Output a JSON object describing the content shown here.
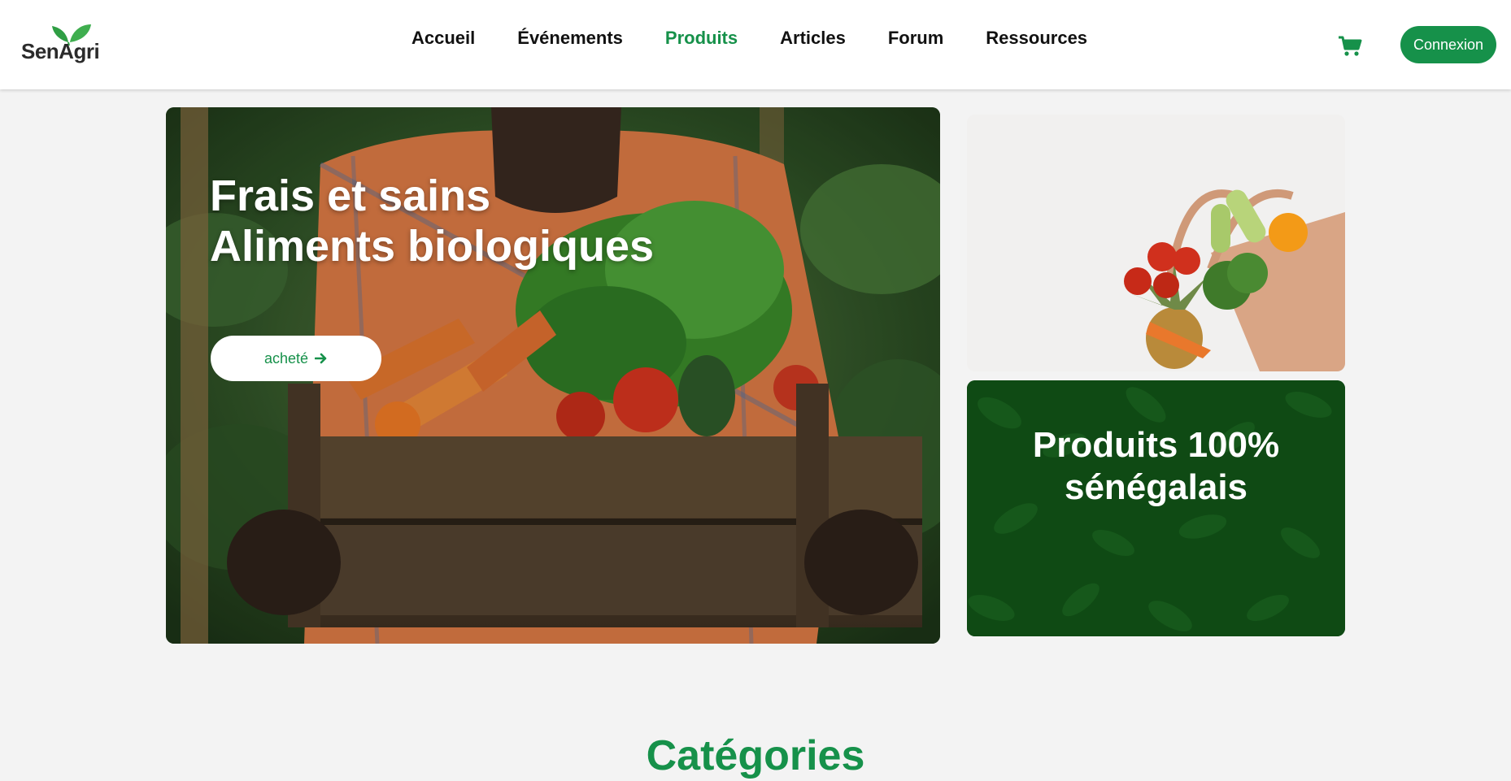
{
  "brand": {
    "name": "SenAgri",
    "accent": "#16914a"
  },
  "nav": {
    "items": [
      {
        "label": "Accueil",
        "active": false
      },
      {
        "label": "Événements",
        "active": false
      },
      {
        "label": "Produits",
        "active": true
      },
      {
        "label": "Articles",
        "active": false
      },
      {
        "label": "Forum",
        "active": false
      },
      {
        "label": "Ressources",
        "active": false
      }
    ],
    "cart_icon": "shopping-cart-icon",
    "login_label": "Connexion"
  },
  "hero": {
    "title_line1": "Frais et sains",
    "title_line2": "Aliments biologiques",
    "button_label": "acheté",
    "button_icon": "arrow-right-icon"
  },
  "promo_cards": {
    "top_image": "grocery-bag-vegetables",
    "bottom_title_line1": "Produits 100%",
    "bottom_title_line2": "sénégalais"
  },
  "sections": {
    "categories_title": "Catégories"
  }
}
